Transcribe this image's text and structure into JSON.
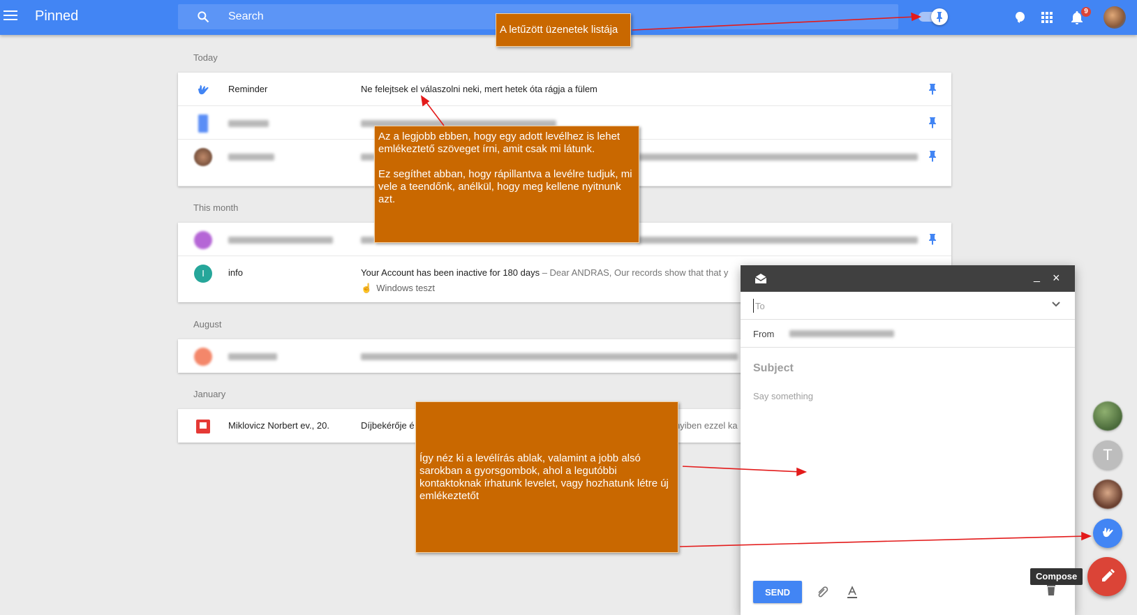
{
  "topbar": {
    "title": "Pinned",
    "search_placeholder": "Search",
    "notification_count": "9",
    "icons": [
      "menu-icon",
      "search-icon",
      "pin-toggle",
      "reminder-bulb-icon",
      "apps-grid-icon",
      "bell-icon",
      "avatar"
    ]
  },
  "sections": {
    "today": "Today",
    "this_month": "This month",
    "august": "August",
    "january": "January"
  },
  "rows": {
    "reminder": {
      "sender": "Reminder",
      "subject": "Ne felejtsek el válaszolni neki, mert hetek óta rágja a fülem"
    },
    "info": {
      "sender": "info",
      "avatar_letter": "I",
      "subject": "Your Account has been inactive for 180 days",
      "snippet": " – Dear ANDRAS, Our records show that that y",
      "reminder_chip": "Windows teszt"
    },
    "miklovicz": {
      "sender": "Miklovicz Norbert ev., 20.",
      "subject": "Díjbekérője é",
      "snippet_tail": "nyiben ezzel ka"
    }
  },
  "compose": {
    "to_placeholder": "To",
    "from_label": "From",
    "subject_placeholder": "Subject",
    "body_placeholder": "Say something",
    "send_label": "SEND"
  },
  "fab": {
    "compose_tooltip": "Compose"
  },
  "annotations": {
    "pinned_list": "A letűzött üzenetek listája",
    "reminder_note_p1": "Az a legjobb ebben, hogy egy adott levélhez is lehet emlékeztető szöveget írni, amit csak mi látunk.",
    "reminder_note_p2": "Ez segíthet abban, hogy rápillantva a levélre tudjuk, mi vele a teendőnk, anélkül, hogy meg kellene nyitnunk azt.",
    "compose_note": "Így néz ki a levélírás ablak, valamint a jobb alsó sarokban a gyorsgombok, ahol a legutóbbi kontaktoknak írhatunk levelet, vagy hozhatunk létre új emlékeztetőt"
  },
  "colors": {
    "brand_blue": "#4285f4",
    "compose_red": "#db4437",
    "annotation_orange": "#c96800",
    "info_teal": "#26a69a"
  }
}
